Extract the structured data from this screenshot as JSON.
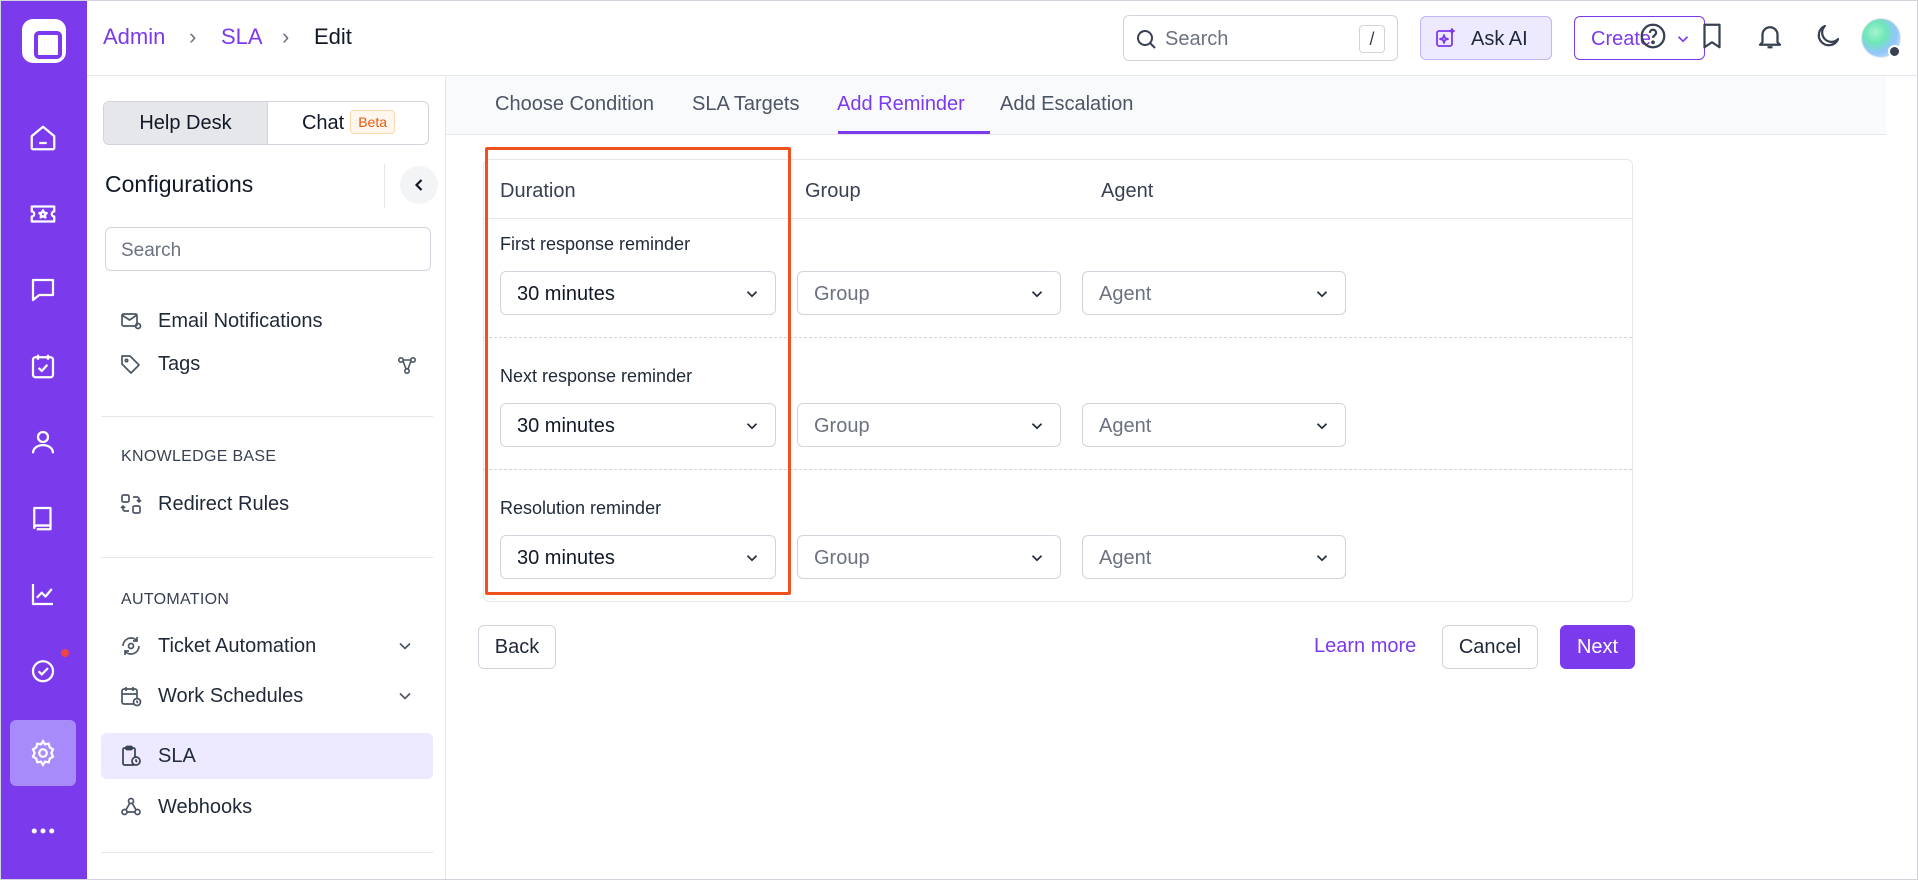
{
  "rail": {
    "items": [
      "home-icon",
      "ticket-icon",
      "chat-icon",
      "tasks-icon",
      "contacts-icon",
      "knowledge-icon",
      "reports-icon",
      "automation-check-icon",
      "settings-icon",
      "more-icon"
    ],
    "active": "settings-icon",
    "accent": "#7c3aed"
  },
  "topbar": {
    "breadcrumb": [
      "Admin",
      "SLA",
      "Edit"
    ],
    "search_placeholder": "Search",
    "search_shortcut": "/",
    "ask_ai_label": "Ask AI",
    "create_label": "Create"
  },
  "sidebar": {
    "segment": {
      "helpdesk": "Help Desk",
      "chat": "Chat",
      "beta_badge": "Beta"
    },
    "title": "Configurations",
    "search_placeholder": "Search",
    "items_top": [
      "Email Notifications",
      "Tags"
    ],
    "knowledge_base_header": "KNOWLEDGE BASE",
    "knowledge_base_items": [
      "Redirect Rules"
    ],
    "automation_header": "AUTOMATION",
    "automation_items": [
      "Ticket Automation",
      "Work Schedules",
      "SLA",
      "Webhooks"
    ],
    "active_item": "SLA"
  },
  "tabs": [
    "Choose Condition",
    "SLA Targets",
    "Add Reminder",
    "Add Escalation"
  ],
  "active_tab": "Add Reminder",
  "reminder_table": {
    "columns": [
      "Duration",
      "Group",
      "Agent"
    ],
    "rows": [
      {
        "label": "First response reminder",
        "duration": "30 minutes",
        "group": "Group",
        "agent": "Agent"
      },
      {
        "label": "Next response reminder",
        "duration": "30 minutes",
        "group": "Group",
        "agent": "Agent"
      },
      {
        "label": "Resolution reminder",
        "duration": "30 minutes",
        "group": "Group",
        "agent": "Agent"
      }
    ]
  },
  "footer": {
    "back_label": "Back",
    "learn_more_label": "Learn more",
    "cancel_label": "Cancel",
    "next_label": "Next"
  },
  "colors": {
    "brand": "#7c3aed",
    "highlight_border": "#f0521f",
    "notification_dot": "#ef4444"
  }
}
